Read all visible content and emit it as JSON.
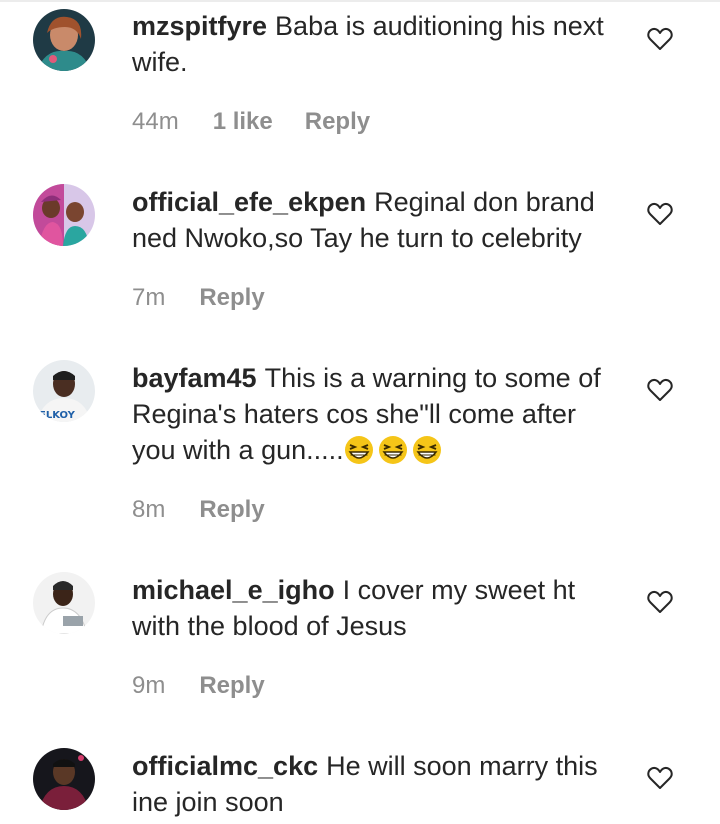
{
  "comments": [
    {
      "username": "mzspitfyre",
      "text": "Baba is auditioning his next wife.",
      "time": "44m",
      "likes": "1 like",
      "reply": "Reply"
    },
    {
      "username": "official_efe_ekpen",
      "text": "Reginal don brand ned Nwoko,so Tay he turn to celebrity",
      "time": "7m",
      "reply": "Reply"
    },
    {
      "username": "bayfam45",
      "text": "This is a warning to some of Regina's haters cos she\"ll come after you with a gun.....",
      "emoji": "grinning-squinting-face-icon x3",
      "time": "8m",
      "reply": "Reply"
    },
    {
      "username": "michael_e_igho",
      "text": "I cover my sweet ht with the blood of Jesus",
      "time": "9m",
      "reply": "Reply"
    },
    {
      "username": "officialmc_ckc",
      "text": "He will soon marry this ine join soon"
    }
  ],
  "icons": {
    "like": "heart-outline-icon",
    "emoji": "grinning-squinting-face-icon"
  },
  "colors": {
    "text": "#262626",
    "meta": "#8e8e8e",
    "emoji": "#f5c518"
  }
}
